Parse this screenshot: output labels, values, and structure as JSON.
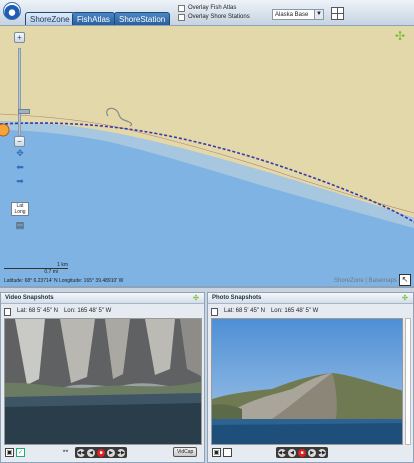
{
  "header": {
    "tabs": [
      {
        "label": "ShoreZone",
        "active": true
      },
      {
        "label": "FishAtlas",
        "active": false
      },
      {
        "label": "ShoreStation",
        "active": false
      }
    ],
    "overlays": [
      {
        "label": "Overlay Fish Atlas",
        "checked": false
      },
      {
        "label": "Overlay Shore Stations",
        "checked": false
      }
    ],
    "basemap": {
      "selected": "Alaska Base"
    }
  },
  "map": {
    "lat_long_button": "Lat Long",
    "scale": {
      "km": "1 km",
      "mi": "0.7 mi"
    },
    "coords": "Latitude: 68° 6.23714' N    Longitude: 165° 39.48910' W",
    "credit": "ShoreZone | Basemaps",
    "colors": {
      "water": "#7fb3e3",
      "land": "#e2d8a9",
      "shallow": "#a7c6e0",
      "track_a": "#1f3fbf",
      "track_b": "#d22c2c"
    }
  },
  "video_panel": {
    "title": "Video Snapshots",
    "lat": "Lat: 68 5' 45\" N",
    "lon": "Lon: 165 48' 5\" W",
    "vidcap_label": "VidCap"
  },
  "photo_panel": {
    "title": "Photo Snapshots",
    "lat": "Lat: 68 5' 45\" N",
    "lon": "Lon: 165 48' 5\" W"
  },
  "controls": {
    "buttons": [
      "rewind",
      "prev",
      "stop",
      "next",
      "forward"
    ]
  }
}
